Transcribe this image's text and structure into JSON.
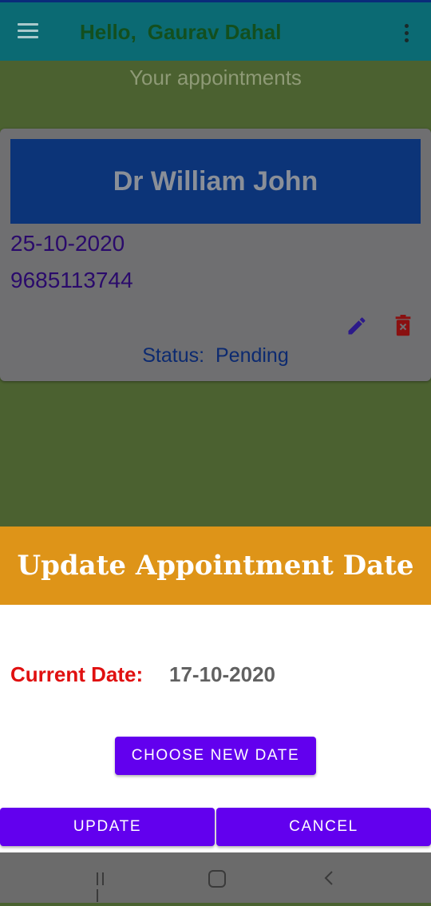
{
  "app_bar": {
    "greeting": "Hello,",
    "user_name": "Gaurav Dahal",
    "menu_icon": "hamburger-menu-icon",
    "overflow_icon": "more-vertical-icon"
  },
  "appointments": {
    "section_title": "Your appointments",
    "items": [
      {
        "doctor": "Dr William John",
        "date": "25-10-2020",
        "phone": "9685113744",
        "status_label": "Status:",
        "status_value": "Pending",
        "edit_icon": "pencil-edit-icon",
        "delete_icon": "trash-delete-icon"
      }
    ]
  },
  "dialog": {
    "title": "Update Appointment Date",
    "current_date_label": "Current Date:",
    "current_date_value": "17-10-2020",
    "choose_button": "CHOOSE NEW DATE",
    "update_button": "UPDATE",
    "cancel_button": "CANCEL"
  },
  "colors": {
    "app_bar": "#0b6a73",
    "dialog_header": "#de9418",
    "button": "#6200ee",
    "current_label": "#e01010"
  },
  "system_nav": {
    "recents_icon": "recents-icon",
    "home_icon": "home-icon",
    "back_icon": "back-chevron-icon"
  }
}
